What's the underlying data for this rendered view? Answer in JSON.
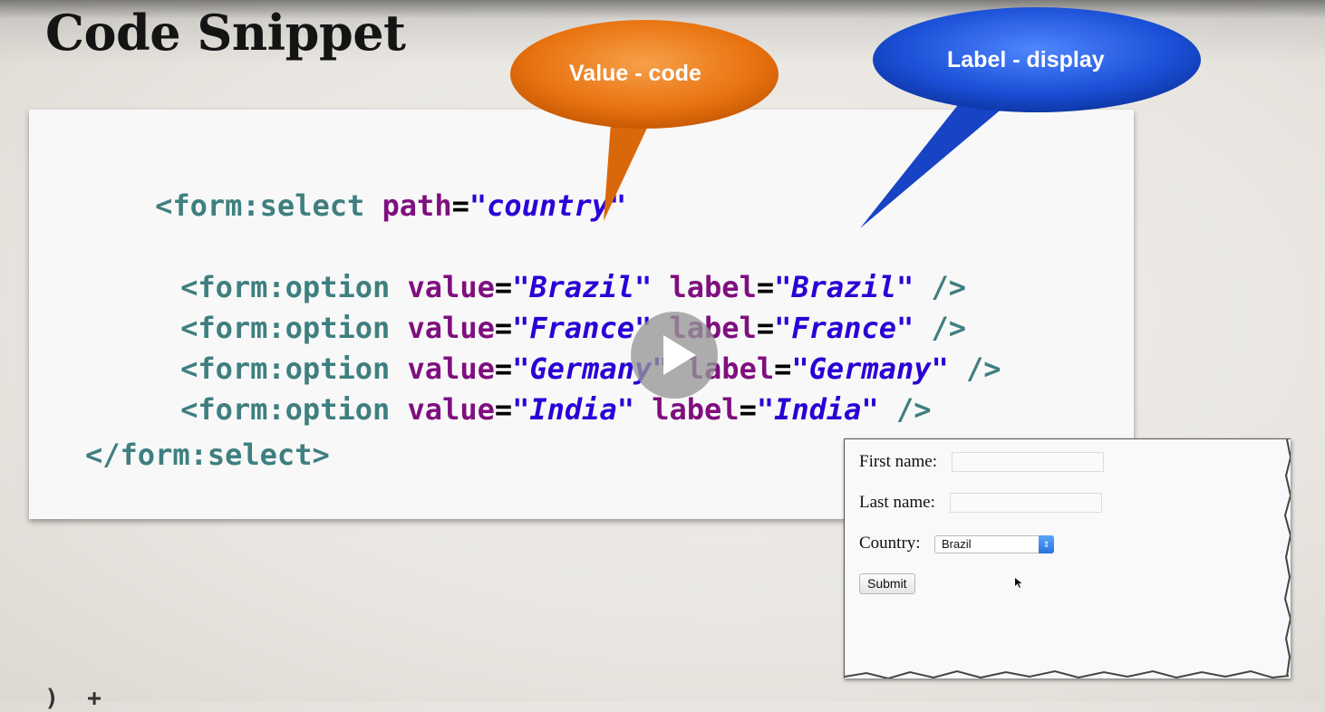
{
  "slide": {
    "title": "Code Snippet",
    "bottom_fragment": "  )  +"
  },
  "code": {
    "line1": {
      "tag": "<form:select",
      "attr": "path",
      "eq": "=",
      "str": "\"country\""
    },
    "options": [
      {
        "tag": "<form:option",
        "attr1": "value",
        "val1": "\"Brazil\"",
        "attr2": "label",
        "val2": "\"Brazil\"",
        "close": "/>"
      },
      {
        "tag": "<form:option",
        "attr1": "value",
        "val1": "\"France\"",
        "attr2": "label",
        "val2": "\"France\"",
        "close": "/>"
      },
      {
        "tag": "<form:option",
        "attr1": "value",
        "val1": "\"Germany\"",
        "attr2": "label",
        "val2": "\"Germany\"",
        "close": "/>"
      },
      {
        "tag": "<form:option",
        "attr1": "value",
        "val1": "\"India\"",
        "attr2": "label",
        "val2": "\"India\"",
        "close": "/>"
      }
    ],
    "closing": "</form:select>",
    "eq": "="
  },
  "callouts": {
    "value_text": "Value - code",
    "label_text": "Label - display",
    "value_color": "#e8720f",
    "label_color": "#1a4fd6"
  },
  "player": {
    "play_icon": "play-icon"
  },
  "form_preview": {
    "first_name_label": "First name:",
    "last_name_label": "Last name:",
    "country_label": "Country:",
    "country_selected": "Brazil",
    "submit_label": "Submit"
  }
}
